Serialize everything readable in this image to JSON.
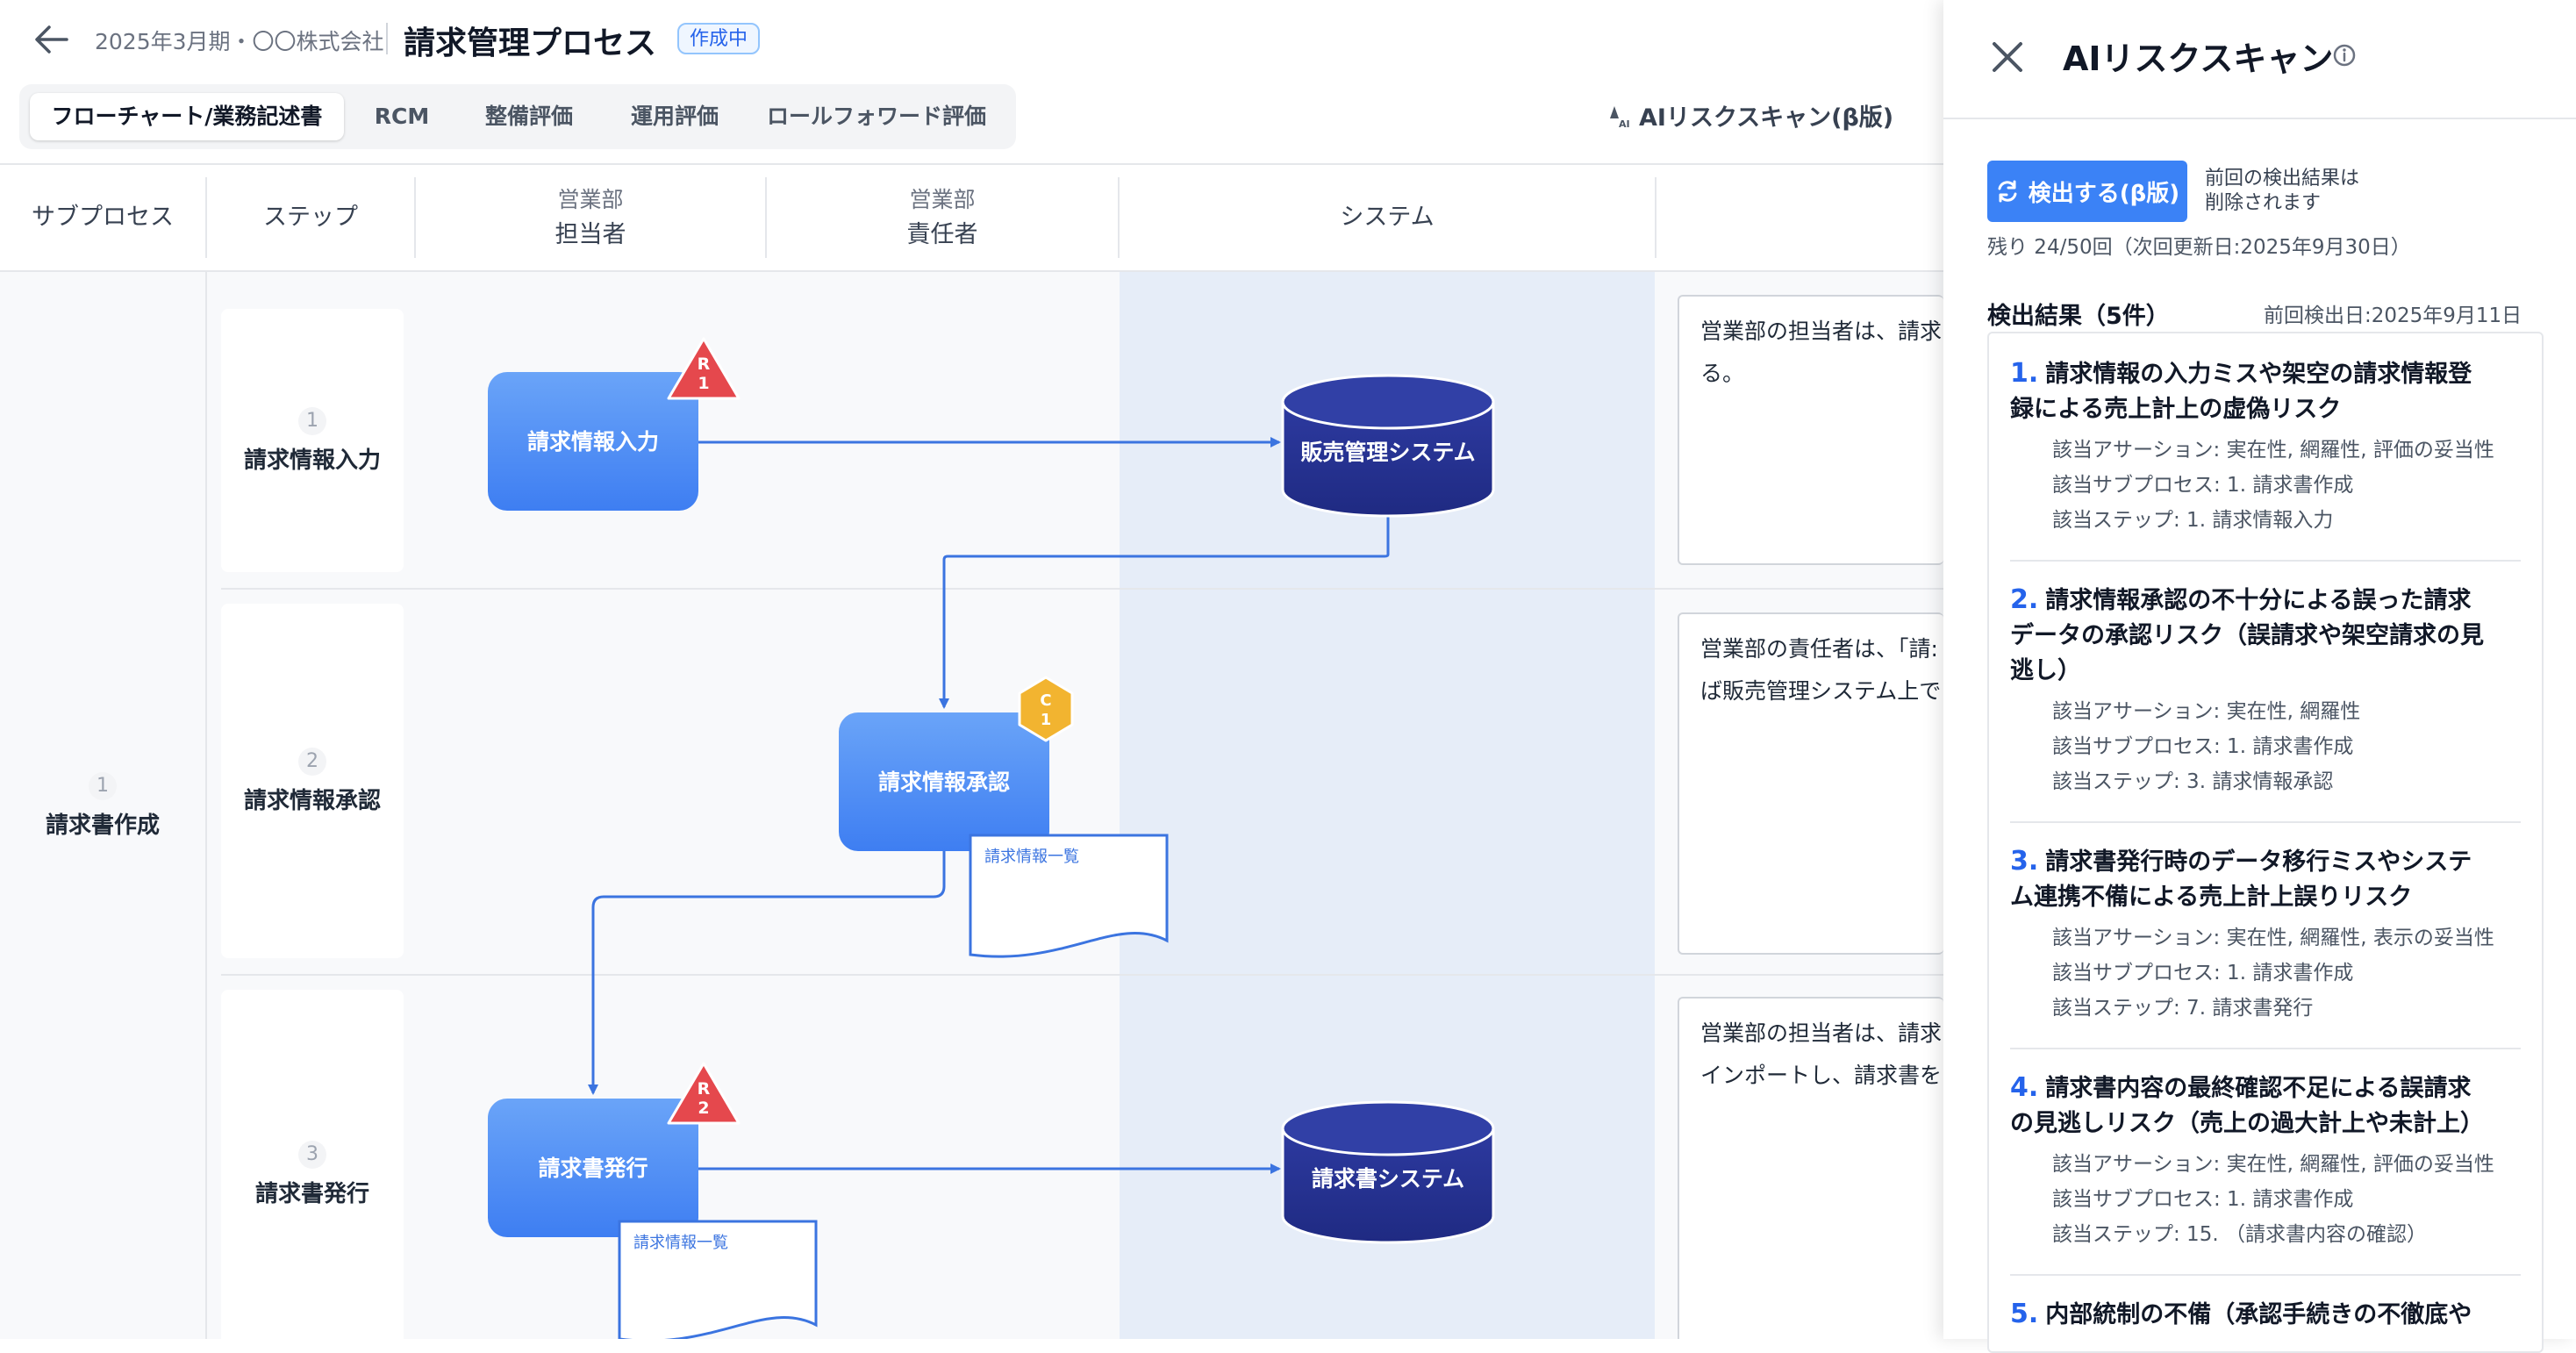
{
  "header": {
    "breadcrumb": "2025年3月期・〇〇株式会社",
    "title": "請求管理プロセス",
    "status": "作成中",
    "tabs": [
      "フローチャート/業務記述書",
      "RCM",
      "整備評価",
      "運用評価",
      "ロールフォワード評価"
    ],
    "ai_link": "AIリスクスキャン(β版)",
    "ai_link_icon": "ai-sparkle-icon"
  },
  "table": {
    "columns": [
      {
        "label": "サブプロセス"
      },
      {
        "label": "ステップ"
      },
      {
        "sub": "営業部",
        "label": "担当者"
      },
      {
        "sub": "営業部",
        "label": "責任者"
      },
      {
        "label": "システム"
      }
    ],
    "subprocess": {
      "num": "1",
      "label": "請求書作成"
    },
    "steps": [
      {
        "num": "1",
        "label": "請求情報入力",
        "desc1": "営業部の担当者は、請求",
        "desc2": "る。"
      },
      {
        "num": "2",
        "label": "請求情報承認",
        "desc1": "営業部の責任者は、「請:",
        "desc2": "ば販売管理システム上で"
      },
      {
        "num": "3",
        "label": "請求書発行",
        "desc1": "営業部の担当者は、請求",
        "desc2": "インポートし、請求書を"
      }
    ]
  },
  "flow": {
    "process1": "請求情報入力",
    "process2": "請求情報承認",
    "process3": "請求書発行",
    "db1": "販売管理システム",
    "db2": "請求書システム",
    "doc1": "請求情報一覧",
    "doc2": "請求情報一覧",
    "risk1": {
      "l1": "R",
      "l2": "1"
    },
    "risk2": {
      "l1": "R",
      "l2": "2"
    },
    "control1": {
      "l1": "C",
      "l2": "1"
    },
    "colors": {
      "process": "#4f8ef5",
      "db": "#26328f",
      "risk": "#e5484d",
      "control": "#f2b430",
      "arrow": "#3b74e0"
    }
  },
  "panel": {
    "title": "AIリスクスキャン",
    "scan_button": "検出する(β版)",
    "scan_note1": "前回の検出結果は",
    "scan_note2": "削除されます",
    "remaining": "残り 24/50回（次回更新日:2025年9月30日）",
    "results_title": "検出結果（5件）",
    "last_date": "前回検出日:2025年9月11日",
    "results": [
      {
        "num": "1.",
        "t1": "請求情報の入力ミスや架空の請求情報登",
        "t2": "録による売上計上の虚偽リスク",
        "t3": "",
        "assertion": "該当アサーション: 実在性, 網羅性, 評価の妥当性",
        "subprocess": "該当サブプロセス: 1. 請求書作成",
        "step": "該当ステップ: 1. 請求情報入力"
      },
      {
        "num": "2.",
        "t1": "請求情報承認の不十分による誤った請求",
        "t2": "データの承認リスク（誤請求や架空請求の見",
        "t3": "逃し）",
        "assertion": "該当アサーション: 実在性, 網羅性",
        "subprocess": "該当サブプロセス: 1. 請求書作成",
        "step": "該当ステップ: 3. 請求情報承認"
      },
      {
        "num": "3.",
        "t1": "請求書発行時のデータ移行ミスやシステ",
        "t2": "ム連携不備による売上計上誤りリスク",
        "t3": "",
        "assertion": "該当アサーション: 実在性, 網羅性, 表示の妥当性",
        "subprocess": "該当サブプロセス: 1. 請求書作成",
        "step": "該当ステップ: 7. 請求書発行"
      },
      {
        "num": "4.",
        "t1": "請求書内容の最終確認不足による誤請求",
        "t2": "の見逃しリスク（売上の過大計上や未計上）",
        "t3": "",
        "assertion": "該当アサーション: 実在性, 網羅性, 評価の妥当性",
        "subprocess": "該当サブプロセス: 1. 請求書作成",
        "step": "該当ステップ: 15. （請求書内容の確認）"
      },
      {
        "num": "5.",
        "t1": "内部統制の不備（承認手続きの不徹底や",
        "t2": "",
        "t3": "",
        "assertion": "",
        "subprocess": "",
        "step": ""
      }
    ]
  }
}
